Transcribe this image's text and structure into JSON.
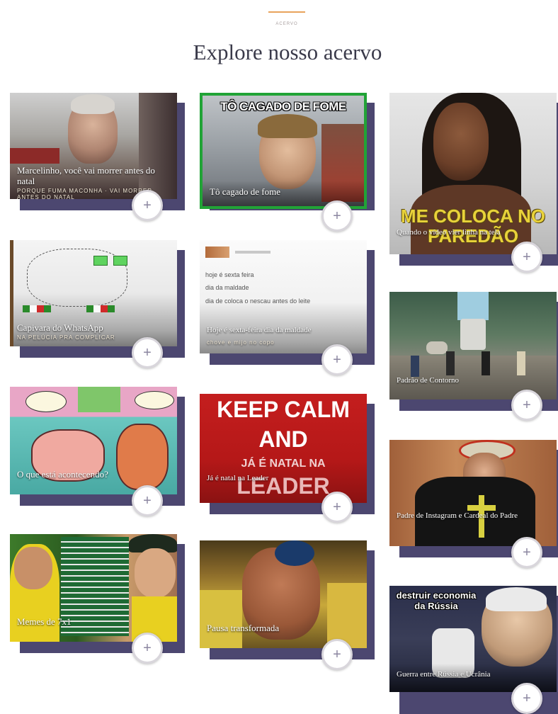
{
  "header": {
    "eyebrow": "ACERVO",
    "title": "Explore nosso acervo"
  },
  "plus_symbol": "+",
  "cards": [
    {
      "caption": "Marcelinho, você vai morrer antes do natal",
      "sub": "PORQUE FUMA MACONHA · VAI MORRER ANTES DO NATAL"
    },
    {
      "caption": "Tô cagado de fome",
      "meme_top": "TÔ CAGADO DE FOME"
    },
    {
      "caption": "Quando o vídeo vier linha na tela",
      "meme_text": "ME COLOCA NO PAREDÃO"
    },
    {
      "caption": "Capivara do WhatsApp",
      "sub": "NA PELÚCIA PRA COMPLICAR"
    },
    {
      "caption": "Hoje é sexta-feira dia da maldade",
      "body_lines": [
        "hoje é sexta feira",
        "dia da maldade",
        "dia de coloca o nescau antes do leite"
      ],
      "sub": "chove e mijo no copo"
    },
    {
      "caption": "Padrão de Contorno"
    },
    {
      "caption": "O que está acontecendo?"
    },
    {
      "caption": "Já é natal na Leader",
      "meme_lines": [
        "KEEP CALM",
        "AND",
        "JÁ É NATAL NA",
        "LEADER"
      ]
    },
    {
      "caption": "Padre de Instagram e Cardeal do Padre"
    },
    {
      "caption": "Memes de 7x1"
    },
    {
      "caption": "Pausa transformada"
    },
    {
      "caption": "Guerra entre Rússia e Ucrânia",
      "meme_top": "destruir economia da Rússia"
    }
  ],
  "colors": {
    "accent": "#e8a35c",
    "card_shadow": "#4c4770",
    "title": "#3a3a4a",
    "plus_border": "#d9d6dc",
    "plus_glyph": "#8b86a0",
    "keep_calm_red": "#c41e1e"
  },
  "icons": [
    "plus-icon"
  ]
}
